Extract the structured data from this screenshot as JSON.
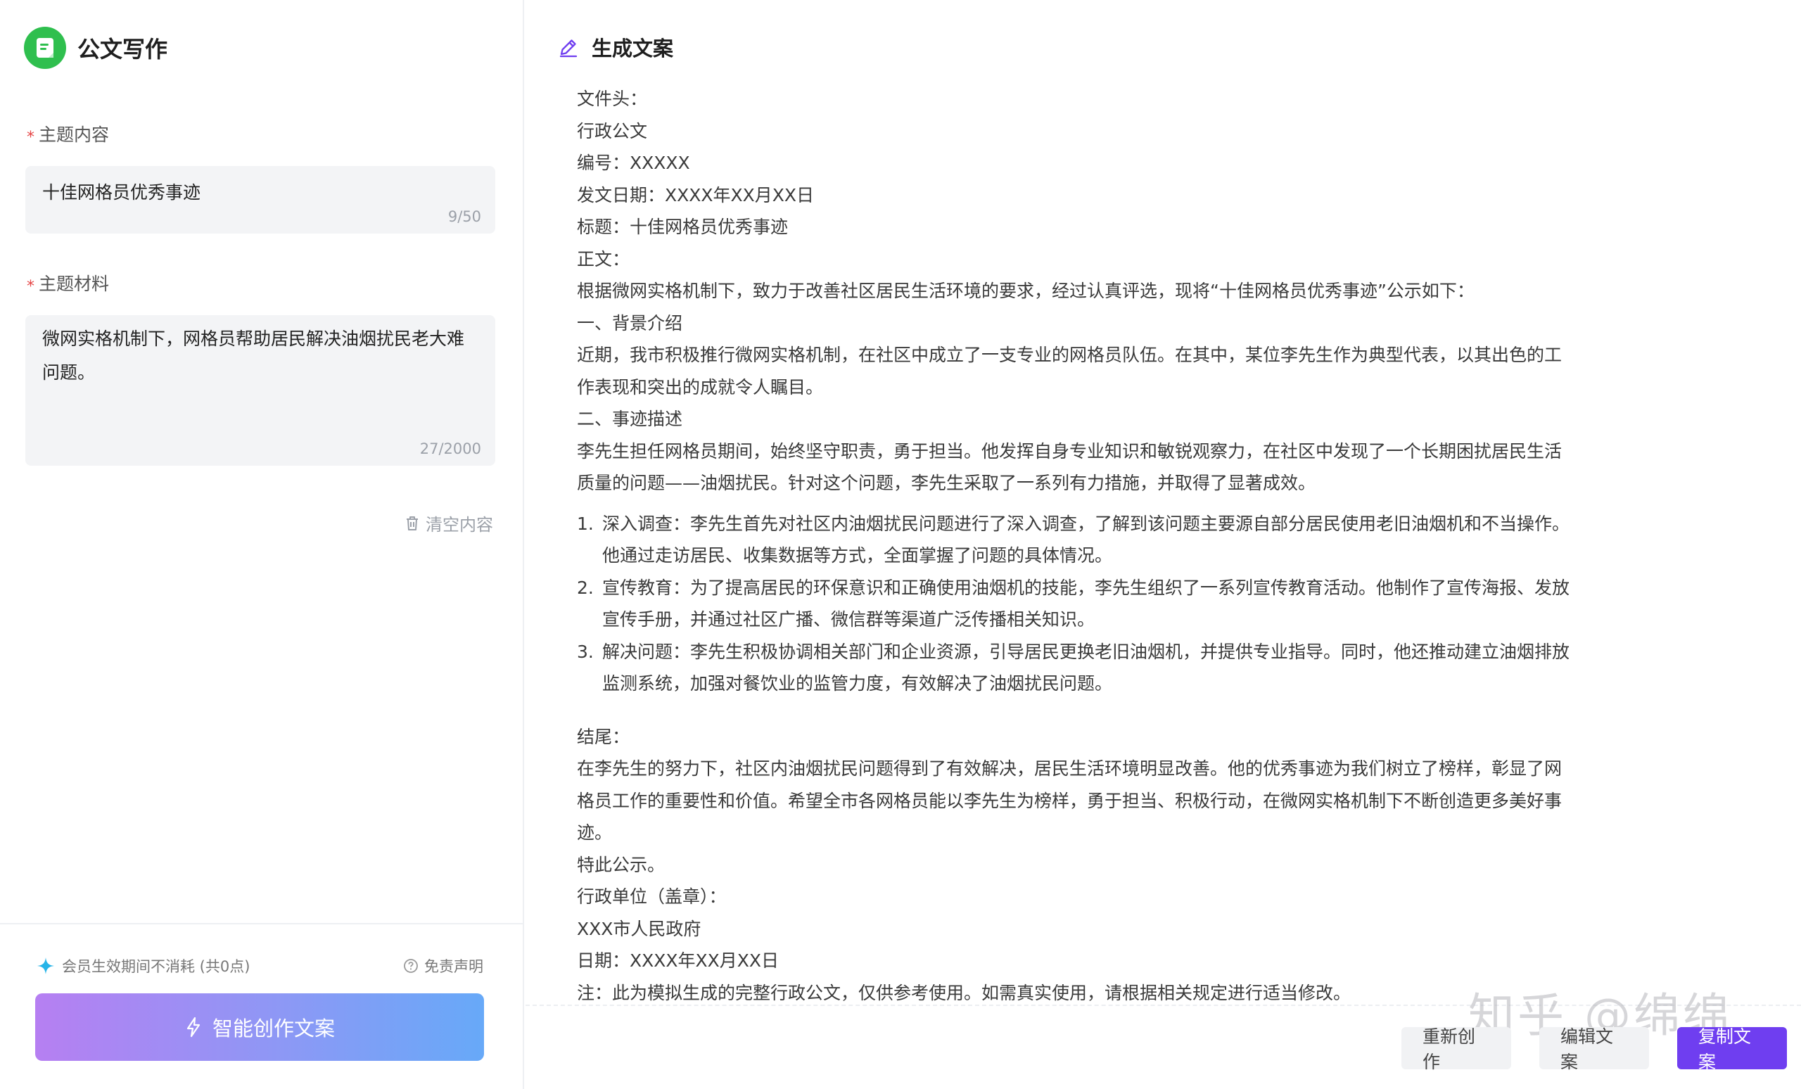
{
  "app": {
    "title": "公文写作",
    "brand_color": "#2fbf4e",
    "accent": "#6f3ef0"
  },
  "topic": {
    "label": "主题内容",
    "value": "十佳网格员优秀事迹",
    "counter": "9/50"
  },
  "material": {
    "label": "主题材料",
    "value": "微网实格机制下，网格员帮助居民解决油烟扰民老大难问题。",
    "counter": "27/2000"
  },
  "clear_label": "清空内容",
  "member_note": "会员生效期间不消耗 (共0点)",
  "disclaimer": "免责声明",
  "create_button": "智能创作文案",
  "generated": {
    "heading": "生成文案",
    "lines_top": [
      "文件头：",
      "行政公文",
      "编号：XXXXX",
      "发文日期：XXXX年XX月XX日",
      "标题：十佳网格员优秀事迹",
      "正文：",
      "根据微网实格机制下，致力于改善社区居民生活环境的要求，经过认真评选，现将“十佳网格员优秀事迹”公示如下：",
      "一、背景介绍",
      "近期，我市积极推行微网实格机制，在社区中成立了一支专业的网格员队伍。在其中，某位李先生作为典型代表，以其出色的工作表现和突出的成就令人瞩目。",
      "二、事迹描述",
      "李先生担任网格员期间，始终坚守职责，勇于担当。他发挥自身专业知识和敏锐观察力，在社区中发现了一个长期困扰居民生活质量的问题——油烟扰民。针对这个问题，李先生采取了一系列有力措施，并取得了显著成效。"
    ],
    "list": [
      {
        "num": "1.",
        "text": "深入调查：李先生首先对社区内油烟扰民问题进行了深入调查，了解到该问题主要源自部分居民使用老旧油烟机和不当操作。他通过走访居民、收集数据等方式，全面掌握了问题的具体情况。"
      },
      {
        "num": "2.",
        "text": "宣传教育：为了提高居民的环保意识和正确使用油烟机的技能，李先生组织了一系列宣传教育活动。他制作了宣传海报、发放宣传手册，并通过社区广播、微信群等渠道广泛传播相关知识。"
      },
      {
        "num": "3.",
        "text": "解决问题：李先生积极协调相关部门和企业资源，引导居民更换老旧油烟机，并提供专业指导。同时，他还推动建立油烟排放监测系统，加强对餐饮业的监管力度，有效解决了油烟扰民问题。"
      }
    ],
    "lines_bottom": [
      "结尾：",
      "在李先生的努力下，社区内油烟扰民问题得到了有效解决，居民生活环境明显改善。他的优秀事迹为我们树立了榜样，彰显了网格员工作的重要性和价值。希望全市各网格员能以李先生为榜样，勇于担当、积极行动，在微网实格机制下不断创造更多美好事迹。",
      "特此公示。",
      "行政单位（盖章）：",
      "XXX市人民政府",
      "日期：XXXX年XX月XX日",
      "注：此为模拟生成的完整行政公文，仅供参考使用。如需真实使用，请根据相关规定进行适当修改。"
    ]
  },
  "actions": {
    "recreate": "重新创作",
    "edit": "编辑文案",
    "copy": "复制文案"
  },
  "watermark": "知乎 @绵绵"
}
